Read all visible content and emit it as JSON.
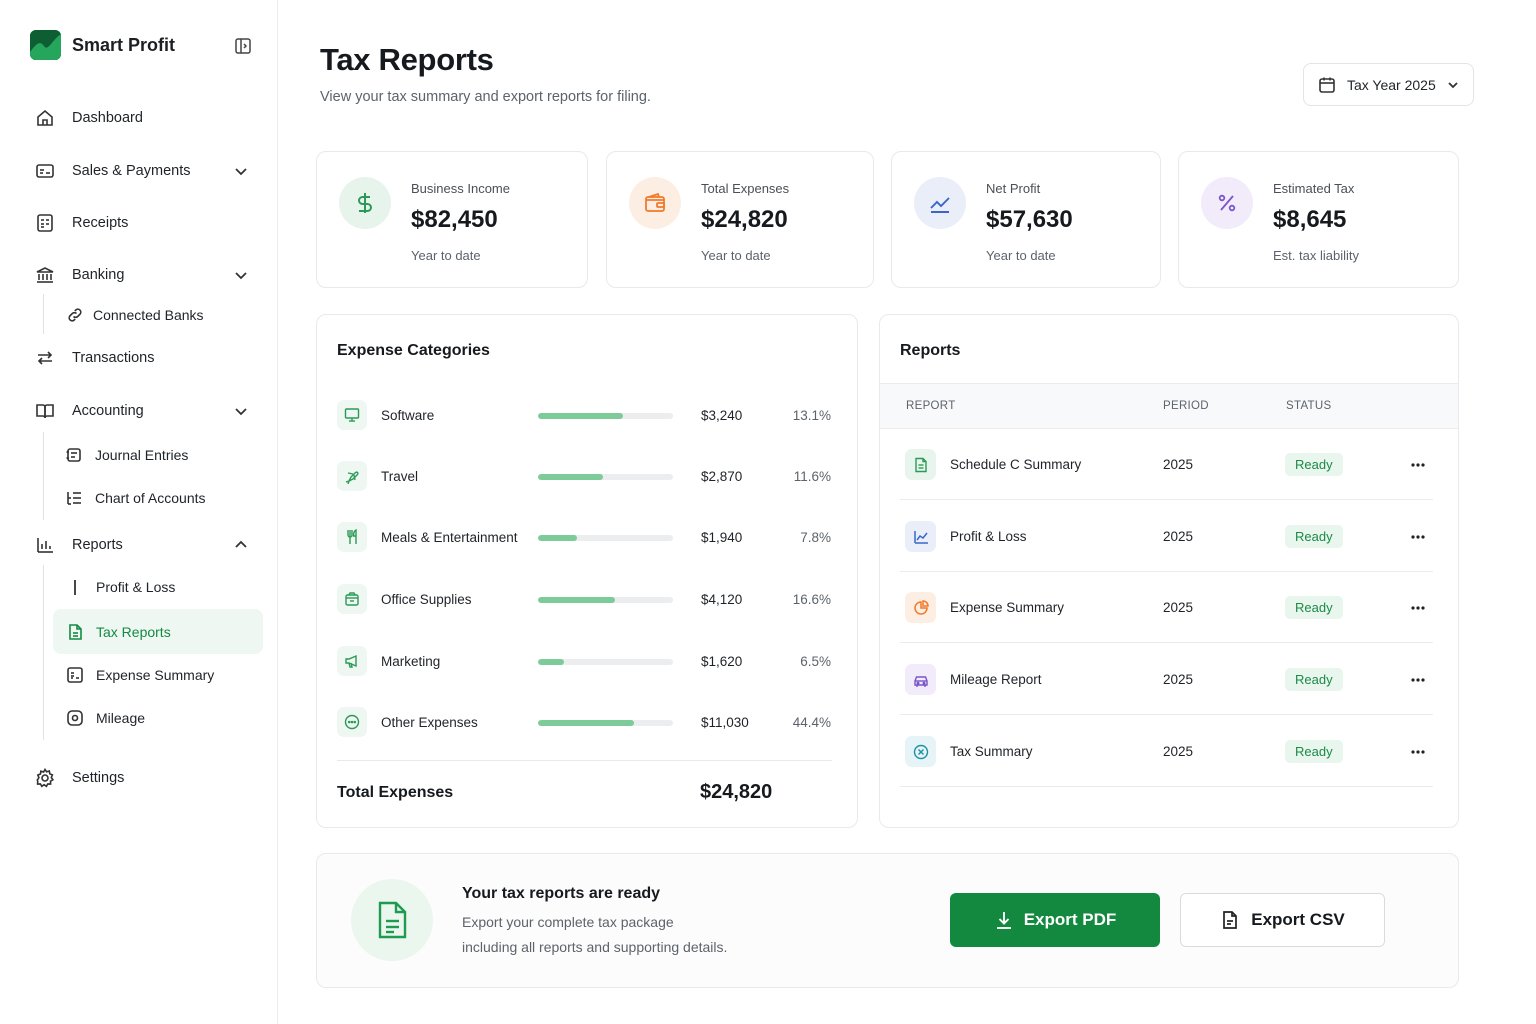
{
  "app": {
    "name": "Smart Profit"
  },
  "sidebar": {
    "items": [
      {
        "label": "Dashboard"
      },
      {
        "label": "Sales & Payments"
      },
      {
        "label": "Receipts"
      },
      {
        "label": "Banking"
      },
      {
        "label": "Connected Banks"
      },
      {
        "label": "Transactions"
      },
      {
        "label": "Accounting"
      },
      {
        "label": "Journal Entries"
      },
      {
        "label": "Chart of Accounts"
      },
      {
        "label": "Reports"
      },
      {
        "label": "Profit & Loss"
      },
      {
        "label": "Tax Reports"
      },
      {
        "label": "Expense Summary"
      },
      {
        "label": "Mileage"
      },
      {
        "label": "Settings"
      }
    ],
    "active": "Tax Reports"
  },
  "header": {
    "title": "Tax Reports",
    "subtitle": "View your tax summary and export reports for filing.",
    "year_selector": "Tax Year 2025"
  },
  "summary_cards": [
    {
      "label": "Business Income",
      "value": "$82,450",
      "note": "Year to date",
      "icon": "dollar-icon",
      "color": "#2c9a57"
    },
    {
      "label": "Total Expenses",
      "value": "$24,820",
      "note": "Year to date",
      "icon": "wallet-icon",
      "color": "#f07a2a"
    },
    {
      "label": "Net Profit",
      "value": "$57,630",
      "note": "Year to date",
      "icon": "trend-line-icon",
      "color": "#3a66c9"
    },
    {
      "label": "Estimated Tax",
      "value": "$8,645",
      "note": "Est. tax liability",
      "icon": "percent-icon",
      "color": "#7b55c9"
    }
  ],
  "expense_categories": {
    "title": "Expense Categories",
    "rows": [
      {
        "name": "Software",
        "amount": "$3,240",
        "percent": "13.1%",
        "fill": 0.63,
        "icon": "monitor-icon"
      },
      {
        "name": "Travel",
        "amount": "$2,870",
        "percent": "11.6%",
        "fill": 0.48,
        "icon": "plane-icon"
      },
      {
        "name": "Meals & Entertainment",
        "amount": "$1,940",
        "percent": "7.8%",
        "fill": 0.29,
        "icon": "utensils-icon"
      },
      {
        "name": "Office Supplies",
        "amount": "$4,120",
        "percent": "16.6%",
        "fill": 0.57,
        "icon": "box-icon"
      },
      {
        "name": "Marketing",
        "amount": "$1,620",
        "percent": "6.5%",
        "fill": 0.19,
        "icon": "megaphone-icon"
      },
      {
        "name": "Other Expenses",
        "amount": "$11,030",
        "percent": "44.4%",
        "fill": 0.71,
        "icon": "more-circle-icon"
      }
    ],
    "total_label": "Total Expenses",
    "total_value": "$24,820"
  },
  "reports": {
    "title": "Reports",
    "columns": [
      "REPORT",
      "PERIOD",
      "STATUS"
    ],
    "rows": [
      {
        "name": "Schedule C Summary",
        "period": "2025",
        "status": "Ready",
        "icon": "document-icon",
        "color": "#2c9a57"
      },
      {
        "name": "Profit & Loss",
        "period": "2025",
        "status": "Ready",
        "icon": "chart-line-icon",
        "color": "#3a66c9"
      },
      {
        "name": "Expense Summary",
        "period": "2025",
        "status": "Ready",
        "icon": "pie-chart-icon",
        "color": "#f07a2a"
      },
      {
        "name": "Mileage Report",
        "period": "2025",
        "status": "Ready",
        "icon": "car-icon",
        "color": "#7b55c9"
      },
      {
        "name": "Tax Summary",
        "period": "2025",
        "status": "Ready",
        "icon": "x-circle-icon",
        "color": "#1f8fa8"
      }
    ]
  },
  "export_banner": {
    "title": "Your tax reports are ready",
    "desc_line1": "Export your complete tax package",
    "desc_line2": "including all reports and supporting details.",
    "pdf_label": "Export PDF",
    "csv_label": "Export CSV"
  }
}
